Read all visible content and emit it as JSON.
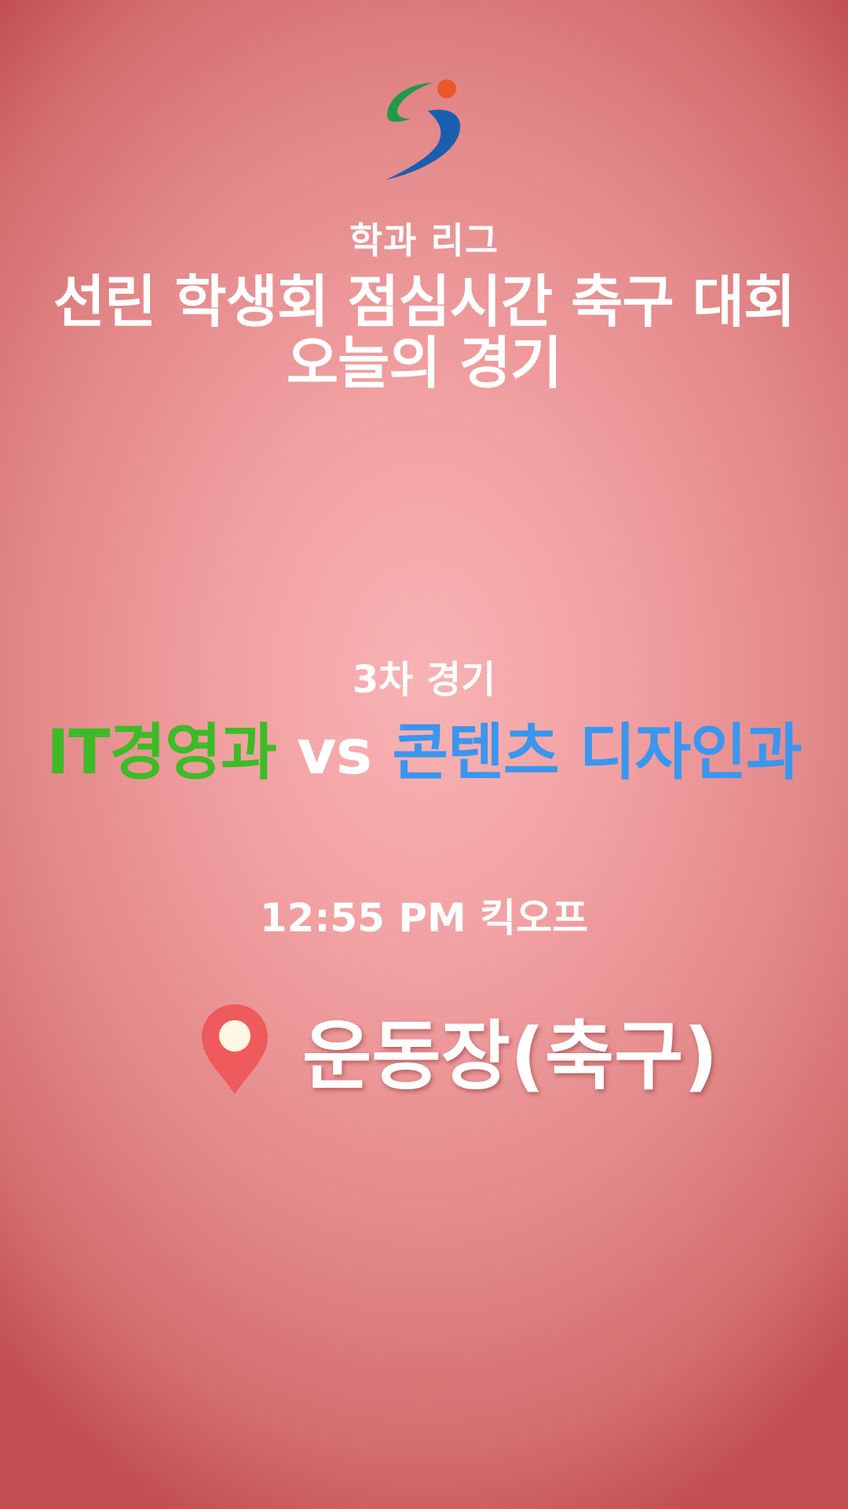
{
  "header": {
    "logo_icon": "school-logo-icon",
    "subtitle": "학과 리그",
    "title_line1": "선린 학생회 점심시간 축구 대회",
    "title_line2": "오늘의 경기"
  },
  "match": {
    "round": "3차 경기",
    "home_team": "IT경영과",
    "vs": "vs",
    "away_team": "콘텐츠 디자인과",
    "kickoff": "12:55 PM 킥오프"
  },
  "venue": {
    "icon": "location-pin-icon",
    "label": "운동장(축구)"
  },
  "colors": {
    "home_team": "#3dbb27",
    "away_team": "#3a96ee",
    "pin": "#ef5a5c",
    "text": "#ffffff"
  }
}
